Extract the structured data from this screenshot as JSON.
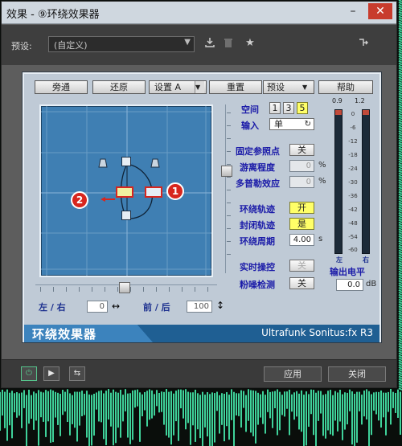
{
  "window": {
    "title": "效果 - ⑨环绕效果器",
    "minimize": "–",
    "close": "✕"
  },
  "topbar": {
    "preset_label": "预设:",
    "preset_value": "(自定义)",
    "icons": [
      "save-preset-icon",
      "delete-preset-icon",
      "favorite-star-icon",
      "routing-icon"
    ]
  },
  "plugin": {
    "buttons": {
      "bypass": "旁通",
      "restore": "还原",
      "settings": "设置 A",
      "reset": "重置",
      "presets": "预设",
      "help": "帮助"
    },
    "space": {
      "label": "空间",
      "options": [
        "1",
        "3",
        "5"
      ],
      "selected": "5"
    },
    "input": {
      "label": "输入",
      "value": "单"
    },
    "fixed_ref": {
      "label": "固定参照点",
      "value": "关"
    },
    "deviation": {
      "label": "游离程度",
      "value": "0",
      "unit": "%"
    },
    "doppler": {
      "label": "多普勒效应",
      "value": "0",
      "unit": "%"
    },
    "surround_track": {
      "label": "环绕轨迹",
      "value": "开"
    },
    "closed_track": {
      "label": "封闭轨迹",
      "value": "是"
    },
    "surround_period": {
      "label": "环绕周期",
      "value": "4.00",
      "unit": "s"
    },
    "realtime": {
      "label": "实时操控",
      "value": "关"
    },
    "pink_noise": {
      "label": "粉噪检测",
      "value": "关"
    },
    "output_level": {
      "label": "输出电平",
      "value": "0.0",
      "unit": "dB"
    },
    "lr": {
      "label": "左 / 右",
      "value": "0",
      "icon": "↔"
    },
    "fb": {
      "label": "前 / 后",
      "value": "100",
      "icon": "↕"
    },
    "meter_top": [
      "0.9",
      "1.2"
    ],
    "meter_scale": [
      "0",
      "-6",
      "-12",
      "-18",
      "-24",
      "-30",
      "-36",
      "-42",
      "-48",
      "-54",
      "-60"
    ],
    "meter_bottom": [
      "左",
      "右"
    ],
    "panel_title": "环绕效果器",
    "brand": "Ultrafunk Sonitus:fx R3",
    "markers": [
      "1",
      "2"
    ]
  },
  "bottom": {
    "apply": "应用",
    "close": "关闭",
    "icons": [
      "power-icon",
      "play-icon",
      "loop-icon"
    ]
  },
  "colors": {
    "grid_bg": "#3f7fb3",
    "panel_bg": "#bfcad6",
    "accent_red": "#d7261e",
    "wave_green": "#3fd29a"
  }
}
